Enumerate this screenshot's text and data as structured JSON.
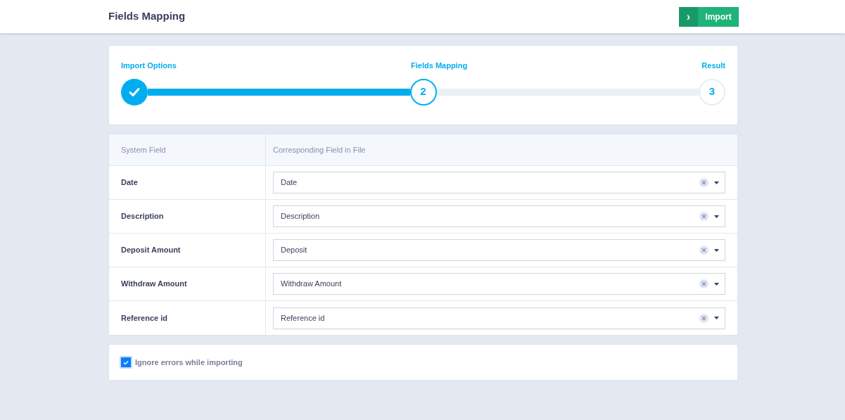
{
  "header": {
    "title": "Fields Mapping",
    "button": {
      "icon": "›",
      "label": "Import"
    }
  },
  "steps": {
    "items": [
      {
        "label": "Import Options",
        "completed": true,
        "selected": false
      },
      {
        "label": "Fields Mapping",
        "number": "2",
        "completed": false,
        "selected": true
      },
      {
        "label": "Result",
        "number": "3",
        "completed": false,
        "selected": false
      }
    ]
  },
  "table": {
    "columns": [
      "System Field",
      "Corresponding Field in File"
    ],
    "rows": [
      {
        "field": "Date",
        "value": "Date"
      },
      {
        "field": "Description",
        "value": "Description"
      },
      {
        "field": "Deposit Amount",
        "value": "Deposit"
      },
      {
        "field": "Withdraw Amount",
        "value": "Withdraw Amount"
      },
      {
        "field": "Reference id",
        "value": "Reference id"
      }
    ]
  },
  "option": {
    "label": "Ignore errors while importing",
    "checked": true
  }
}
